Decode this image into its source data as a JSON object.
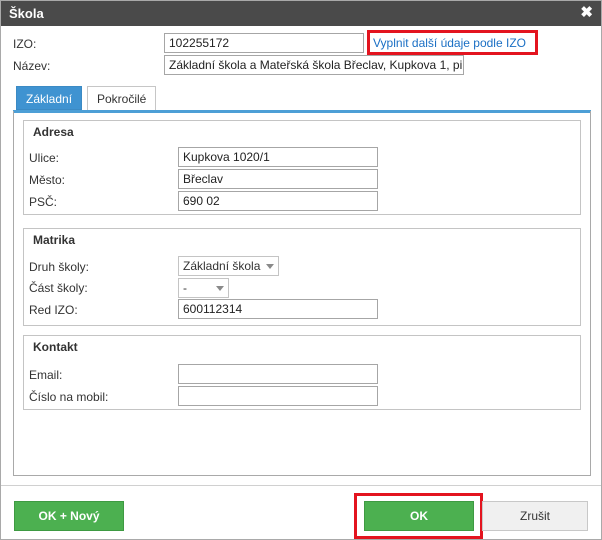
{
  "dialog": {
    "title": "Škola",
    "close_icon": "close-icon"
  },
  "header": {
    "izo_label": "IZO:",
    "izo_value": "102255172",
    "fill_link": "Vyplnit další údaje podle IZO",
    "name_label": "Název:",
    "name_value": "Základní škola a Mateřská škola Břeclav, Kupkova 1, pi"
  },
  "tabs": [
    {
      "label": "Základní",
      "active": true
    },
    {
      "label": "Pokročilé",
      "active": false
    }
  ],
  "adresa": {
    "legend": "Adresa",
    "ulice_label": "Ulice:",
    "ulice_value": "Kupkova 1020/1",
    "mesto_label": "Město:",
    "mesto_value": "Břeclav",
    "psc_label": "PSČ:",
    "psc_value": "690 02"
  },
  "matrika": {
    "legend": "Matrika",
    "druh_label": "Druh školy:",
    "druh_value": "Základní škola",
    "cast_label": "Část školy:",
    "cast_value": "-",
    "redizo_label": "Red IZO:",
    "redizo_value": "600112314"
  },
  "kontakt": {
    "legend": "Kontakt",
    "email_label": "Email:",
    "email_value": "",
    "mobil_label": "Číslo na mobil:",
    "mobil_value": ""
  },
  "footer": {
    "ok_new_label": "OK + Nový",
    "ok_label": "OK",
    "cancel_label": "Zrušit"
  },
  "colors": {
    "title_bar": "#4a4a4a",
    "accent_blue": "#3f93d1",
    "button_green": "#4cb050",
    "highlight_red": "#e3141f"
  }
}
